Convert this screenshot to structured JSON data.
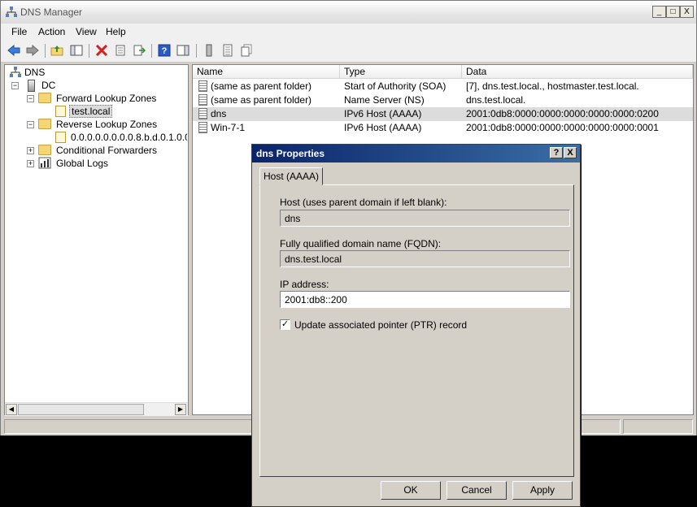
{
  "window": {
    "title": "DNS Manager",
    "minimize": "_",
    "maximize": "□",
    "close": "X"
  },
  "menu": {
    "items": [
      "File",
      "Action",
      "View",
      "Help"
    ]
  },
  "tree": {
    "root": "DNS",
    "server": "DC",
    "forward_zones": "Forward Lookup Zones",
    "zone": "test.local",
    "reverse_zones": "Reverse Lookup Zones",
    "reverse_zone": "0.0.0.0.0.0.0.0.8.b.d.0.1.0.0",
    "conditional": "Conditional Forwarders",
    "global_logs": "Global Logs"
  },
  "list": {
    "columns": [
      "Name",
      "Type",
      "Data"
    ],
    "rows": [
      {
        "name": "(same as parent folder)",
        "type": "Start of Authority (SOA)",
        "data": "[7], dns.test.local., hostmaster.test.local."
      },
      {
        "name": "(same as parent folder)",
        "type": "Name Server (NS)",
        "data": "dns.test.local."
      },
      {
        "name": "dns",
        "type": "IPv6 Host (AAAA)",
        "data": "2001:0db8:0000:0000:0000:0000:0000:0200"
      },
      {
        "name": "Win-7-1",
        "type": "IPv6 Host (AAAA)",
        "data": "2001:0db8:0000:0000:0000:0000:0000:0001"
      }
    ]
  },
  "dialog": {
    "title": "dns Properties",
    "help": "?",
    "close": "X",
    "tab": "Host (AAAA)",
    "host_label": "Host (uses parent domain if left blank):",
    "host_value": "dns",
    "fqdn_label": "Fully qualified domain name (FQDN):",
    "fqdn_value": "dns.test.local",
    "ip_label": "IP address:",
    "ip_value": "2001:db8::200",
    "ptr_label": "Update associated pointer (PTR) record",
    "ptr_checked": "✓",
    "ok": "OK",
    "cancel": "Cancel",
    "apply": "Apply"
  }
}
